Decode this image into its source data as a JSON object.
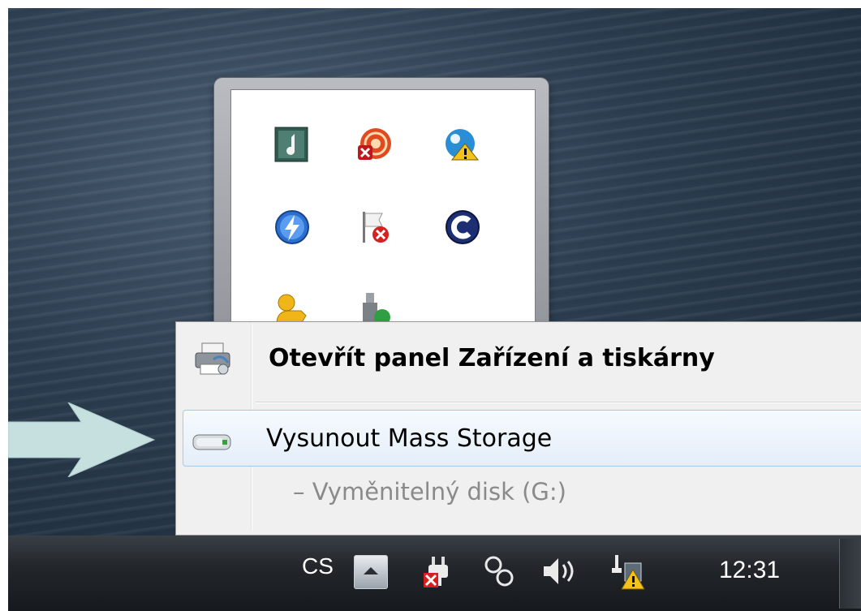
{
  "menu": {
    "open_devices_label": "Otevřít panel Zařízení a tiskárny",
    "eject_label": "Vysunout Mass Storage",
    "drive_label": "–  Vyměnitelný disk (G:)"
  },
  "tray_overflow": {
    "icons": [
      "music-icon",
      "rss-error-icon",
      "network-warning-icon",
      "flash-icon",
      "action-center-error-flag-icon",
      "c-app-icon",
      "key-user-icon",
      "usb-device-icon"
    ]
  },
  "taskbar": {
    "language": "CS",
    "clock": "12:31",
    "icons": [
      "show-hidden-icons-icon",
      "power-unplugged-icon",
      "sync-icon",
      "volume-icon",
      "network-warning-icon"
    ]
  },
  "colors": {
    "highlight_border": "#a8c8ea",
    "arrow_fill": "#c6e0df",
    "taskbar": "#1b1e22"
  }
}
